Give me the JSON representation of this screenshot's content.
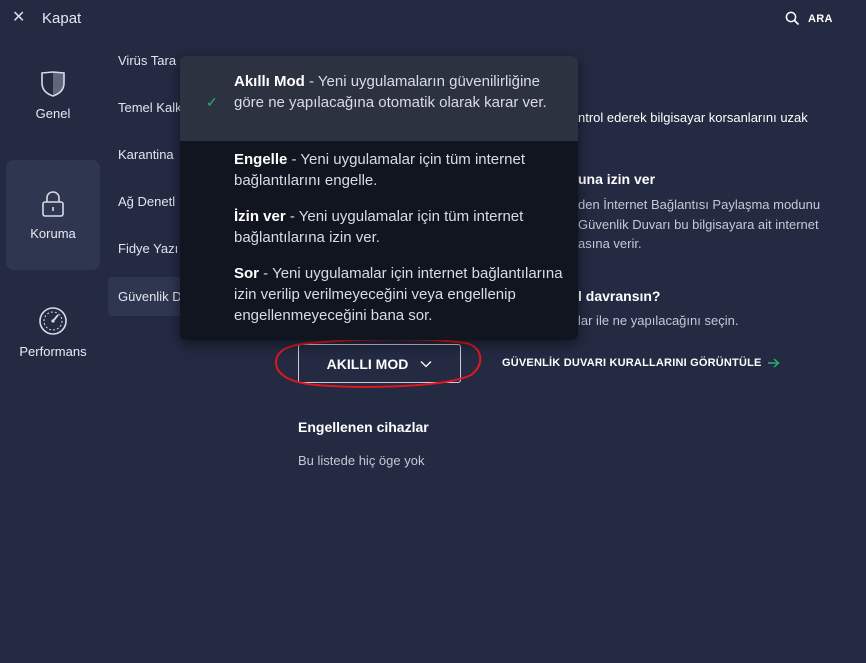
{
  "topbar": {
    "close_label": "Kapat",
    "search_label": "ARA"
  },
  "nav": {
    "items": [
      {
        "label": "Genel",
        "icon": "shield-icon"
      },
      {
        "label": "Koruma",
        "icon": "lock-icon"
      },
      {
        "label": "Performans",
        "icon": "speedometer-icon"
      }
    ]
  },
  "subnav": {
    "items": [
      "Virüs Tara",
      "Temel Kalk",
      "Karantina",
      "Ağ Denetl",
      "Fidye Yazı",
      "Güvenlik D"
    ]
  },
  "main": {
    "desc_line1": "ntrol ederek bilgisayar korsanlarını uzak",
    "section_title": "una izin ver",
    "section_desc_1": "den İnternet Bağlantısı Paylaşma modunu",
    "section_desc_2": "Güvenlik Duvarı bu bilgisayara ait internet",
    "section_desc_3": "asına verir.",
    "behavior_title": "l davransın?",
    "behavior_desc": "lar ile ne yapılacağını seçin.",
    "mode_value": "AKILLI MOD",
    "rules_link": "GÜVENLİK DUVARI KURALLARINI GÖRÜNTÜLE",
    "blocked_title": "Engellenen cihazlar",
    "blocked_empty": "Bu listede hiç öge yok"
  },
  "dropdown": {
    "options": [
      {
        "name": "Akıllı Mod",
        "desc": " - Yeni uygulamaların güvenilirliğine göre ne yapılacağına otomatik olarak karar ver."
      },
      {
        "name": "Engelle",
        "desc": " - Yeni uygulamalar için tüm internet bağlantılarını engelle."
      },
      {
        "name": "İzin ver",
        "desc": " - Yeni uygulamalar için tüm internet bağlantılarına izin ver."
      },
      {
        "name": "Sor",
        "desc": " - Yeni uygulamalar için internet bağlantılarına izin verilip verilmeyeceğini veya engellenip engellenmeyeceğini bana sor."
      }
    ]
  },
  "colors": {
    "background": "#232a42",
    "accent_green": "#22b36f",
    "annotation_red": "#e0181e"
  }
}
